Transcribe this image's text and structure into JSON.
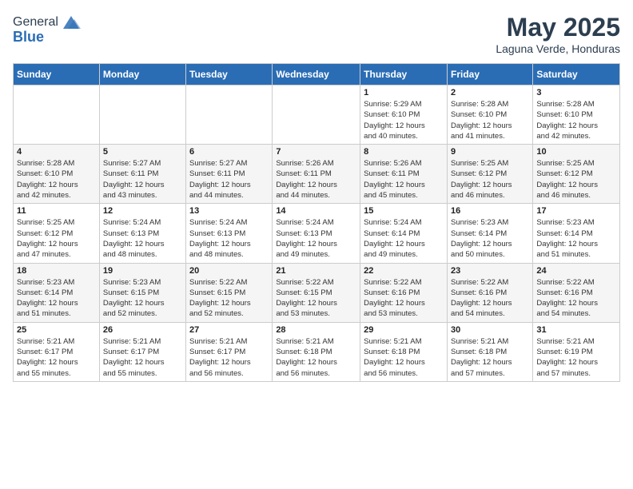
{
  "header": {
    "logo_general": "General",
    "logo_blue": "Blue",
    "month_year": "May 2025",
    "location": "Laguna Verde, Honduras"
  },
  "weekdays": [
    "Sunday",
    "Monday",
    "Tuesday",
    "Wednesday",
    "Thursday",
    "Friday",
    "Saturday"
  ],
  "weeks": [
    [
      {
        "day": "",
        "info": ""
      },
      {
        "day": "",
        "info": ""
      },
      {
        "day": "",
        "info": ""
      },
      {
        "day": "",
        "info": ""
      },
      {
        "day": "1",
        "info": "Sunrise: 5:29 AM\nSunset: 6:10 PM\nDaylight: 12 hours\nand 40 minutes."
      },
      {
        "day": "2",
        "info": "Sunrise: 5:28 AM\nSunset: 6:10 PM\nDaylight: 12 hours\nand 41 minutes."
      },
      {
        "day": "3",
        "info": "Sunrise: 5:28 AM\nSunset: 6:10 PM\nDaylight: 12 hours\nand 42 minutes."
      }
    ],
    [
      {
        "day": "4",
        "info": "Sunrise: 5:28 AM\nSunset: 6:10 PM\nDaylight: 12 hours\nand 42 minutes."
      },
      {
        "day": "5",
        "info": "Sunrise: 5:27 AM\nSunset: 6:11 PM\nDaylight: 12 hours\nand 43 minutes."
      },
      {
        "day": "6",
        "info": "Sunrise: 5:27 AM\nSunset: 6:11 PM\nDaylight: 12 hours\nand 44 minutes."
      },
      {
        "day": "7",
        "info": "Sunrise: 5:26 AM\nSunset: 6:11 PM\nDaylight: 12 hours\nand 44 minutes."
      },
      {
        "day": "8",
        "info": "Sunrise: 5:26 AM\nSunset: 6:11 PM\nDaylight: 12 hours\nand 45 minutes."
      },
      {
        "day": "9",
        "info": "Sunrise: 5:25 AM\nSunset: 6:12 PM\nDaylight: 12 hours\nand 46 minutes."
      },
      {
        "day": "10",
        "info": "Sunrise: 5:25 AM\nSunset: 6:12 PM\nDaylight: 12 hours\nand 46 minutes."
      }
    ],
    [
      {
        "day": "11",
        "info": "Sunrise: 5:25 AM\nSunset: 6:12 PM\nDaylight: 12 hours\nand 47 minutes."
      },
      {
        "day": "12",
        "info": "Sunrise: 5:24 AM\nSunset: 6:13 PM\nDaylight: 12 hours\nand 48 minutes."
      },
      {
        "day": "13",
        "info": "Sunrise: 5:24 AM\nSunset: 6:13 PM\nDaylight: 12 hours\nand 48 minutes."
      },
      {
        "day": "14",
        "info": "Sunrise: 5:24 AM\nSunset: 6:13 PM\nDaylight: 12 hours\nand 49 minutes."
      },
      {
        "day": "15",
        "info": "Sunrise: 5:24 AM\nSunset: 6:14 PM\nDaylight: 12 hours\nand 49 minutes."
      },
      {
        "day": "16",
        "info": "Sunrise: 5:23 AM\nSunset: 6:14 PM\nDaylight: 12 hours\nand 50 minutes."
      },
      {
        "day": "17",
        "info": "Sunrise: 5:23 AM\nSunset: 6:14 PM\nDaylight: 12 hours\nand 51 minutes."
      }
    ],
    [
      {
        "day": "18",
        "info": "Sunrise: 5:23 AM\nSunset: 6:14 PM\nDaylight: 12 hours\nand 51 minutes."
      },
      {
        "day": "19",
        "info": "Sunrise: 5:23 AM\nSunset: 6:15 PM\nDaylight: 12 hours\nand 52 minutes."
      },
      {
        "day": "20",
        "info": "Sunrise: 5:22 AM\nSunset: 6:15 PM\nDaylight: 12 hours\nand 52 minutes."
      },
      {
        "day": "21",
        "info": "Sunrise: 5:22 AM\nSunset: 6:15 PM\nDaylight: 12 hours\nand 53 minutes."
      },
      {
        "day": "22",
        "info": "Sunrise: 5:22 AM\nSunset: 6:16 PM\nDaylight: 12 hours\nand 53 minutes."
      },
      {
        "day": "23",
        "info": "Sunrise: 5:22 AM\nSunset: 6:16 PM\nDaylight: 12 hours\nand 54 minutes."
      },
      {
        "day": "24",
        "info": "Sunrise: 5:22 AM\nSunset: 6:16 PM\nDaylight: 12 hours\nand 54 minutes."
      }
    ],
    [
      {
        "day": "25",
        "info": "Sunrise: 5:21 AM\nSunset: 6:17 PM\nDaylight: 12 hours\nand 55 minutes."
      },
      {
        "day": "26",
        "info": "Sunrise: 5:21 AM\nSunset: 6:17 PM\nDaylight: 12 hours\nand 55 minutes."
      },
      {
        "day": "27",
        "info": "Sunrise: 5:21 AM\nSunset: 6:17 PM\nDaylight: 12 hours\nand 56 minutes."
      },
      {
        "day": "28",
        "info": "Sunrise: 5:21 AM\nSunset: 6:18 PM\nDaylight: 12 hours\nand 56 minutes."
      },
      {
        "day": "29",
        "info": "Sunrise: 5:21 AM\nSunset: 6:18 PM\nDaylight: 12 hours\nand 56 minutes."
      },
      {
        "day": "30",
        "info": "Sunrise: 5:21 AM\nSunset: 6:18 PM\nDaylight: 12 hours\nand 57 minutes."
      },
      {
        "day": "31",
        "info": "Sunrise: 5:21 AM\nSunset: 6:19 PM\nDaylight: 12 hours\nand 57 minutes."
      }
    ]
  ]
}
